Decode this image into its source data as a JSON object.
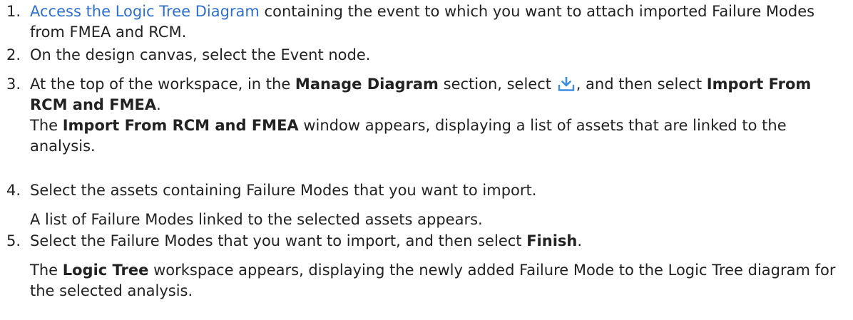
{
  "steps": [
    {
      "number": "1.",
      "link": "Access the Logic Tree Diagram",
      "text": " containing the event to which you want to attach imported Failure Modes from FMEA and RCM."
    },
    {
      "number": "2.",
      "text": "On the design canvas, select the Event node."
    },
    {
      "number": "3.",
      "pre": "At the top of the workspace, in the ",
      "bold1": "Manage Diagram",
      "mid": " section, select ",
      "icon": "download-icon",
      "post": ", and then select ",
      "bold2": "Import From RCM and FMEA",
      "end": ".",
      "result_bold": "Import From RCM and FMEA",
      "result_pre": "The ",
      "result_text": " window appears, displaying a list of assets that are linked to the analysis."
    },
    {
      "number": "4.",
      "text": "Select the assets containing Failure Modes that you want to import.",
      "result": "A list of Failure Modes linked to the selected assets appears."
    },
    {
      "number": "5.",
      "pre": "Select the Failure Modes that you want to import, and then select ",
      "bold": "Finish",
      "end": ".",
      "result_pre": "The ",
      "result_bold": "Logic Tree",
      "result_text": " workspace appears, displaying the newly added Failure Mode to the Logic Tree diagram for the selected analysis."
    }
  ],
  "colors": {
    "link": "#2f6fd0",
    "icon": "#3b8fe0"
  }
}
